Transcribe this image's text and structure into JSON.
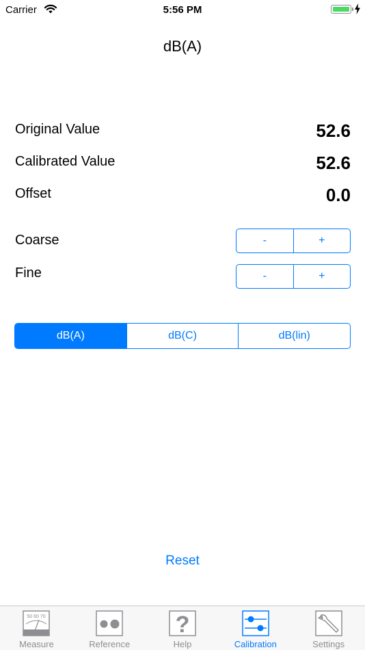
{
  "status": {
    "carrier": "Carrier",
    "time": "5:56 PM"
  },
  "title": "dB(A)",
  "values": {
    "original_label": "Original Value",
    "original_value": "52.6",
    "calibrated_label": "Calibrated Value",
    "calibrated_value": "52.6",
    "offset_label": "Offset",
    "offset_value": "0.0"
  },
  "adjust": {
    "coarse_label": "Coarse",
    "fine_label": "Fine",
    "minus": "-",
    "plus": "+"
  },
  "weighting": {
    "options": [
      "dB(A)",
      "dB(C)",
      "dB(lin)"
    ],
    "selected": "dB(A)"
  },
  "reset_label": "Reset",
  "tabs": [
    {
      "label": "Measure",
      "icon": "meter-icon",
      "meter_scale": "50 60 70"
    },
    {
      "label": "Reference",
      "icon": "dots-icon"
    },
    {
      "label": "Help",
      "icon": "question-icon",
      "glyph": "?"
    },
    {
      "label": "Calibration",
      "icon": "sliders-icon"
    },
    {
      "label": "Settings",
      "icon": "wrench-icon"
    }
  ],
  "active_tab": "Calibration",
  "colors": {
    "accent": "#007aff",
    "inactive": "#8e8e93",
    "battery": "#4cd964"
  }
}
